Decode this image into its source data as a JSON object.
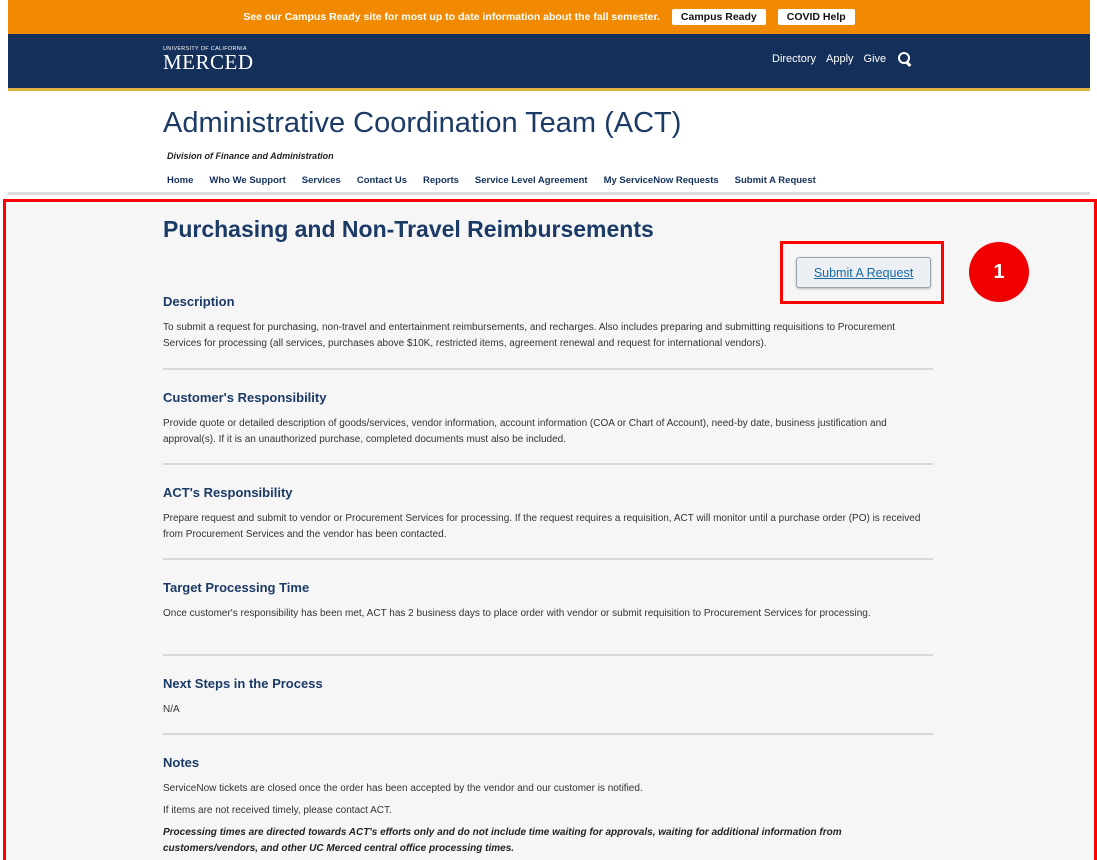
{
  "alert": {
    "text": "See our Campus Ready site for most up to date information about the fall semester.",
    "buttons": [
      "Campus Ready",
      "COVID Help"
    ]
  },
  "brand": {
    "logo_small": "UNIVERSITY OF CALIFORNIA",
    "logo_big": "MERCED",
    "links": [
      "Directory",
      "Apply",
      "Give"
    ],
    "icon": "search-icon"
  },
  "site": {
    "title": "Administrative Coordination Team (ACT)",
    "subtitle": "Division of Finance and Administration",
    "nav": [
      "Home",
      "Who We Support",
      "Services",
      "Contact Us",
      "Reports",
      "Service Level Agreement",
      "My ServiceNow Requests",
      "Submit A Request"
    ]
  },
  "page": {
    "title": "Purchasing and Non-Travel Reimbursements",
    "submit_label": "Submit A Request",
    "step_badge": "1",
    "sections": [
      {
        "heading": "Description",
        "paragraphs": [
          "To submit a request for purchasing, non-travel and entertainment reimbursements, and recharges. Also includes preparing and submitting requisitions to Procurement Services for processing (all services, purchases above $10K, restricted items, agreement renewal and request for international vendors)."
        ]
      },
      {
        "heading": "Customer's Responsibility",
        "paragraphs": [
          "Provide quote or detailed description of goods/services, vendor information, account information (COA or Chart of Account), need-by date, business justification and approval(s). If it is an unauthorized purchase, completed documents must also be included."
        ]
      },
      {
        "heading": "ACT's Responsibility",
        "paragraphs": [
          "Prepare request and submit to vendor or Procurement Services for processing. If the request requires a requisition, ACT will monitor until a purchase order (PO) is received from Procurement Services and the vendor has been contacted."
        ]
      },
      {
        "heading": "Target Processing Time",
        "paragraphs": [
          "Once customer's responsibility has been met, ACT has 2 business days to place order with vendor or submit requisition to Procurement Services for processing."
        ]
      },
      {
        "heading": "Next Steps in the Process",
        "paragraphs": [
          "N/A"
        ]
      },
      {
        "heading": "Notes",
        "paragraphs": [
          "ServiceNow tickets are closed once the order has been accepted by the vendor and our customer is notified.",
          "If items are not received timely, please contact ACT.",
          "Processing times are directed towards ACT's efforts only and do not include time waiting for approvals, waiting for additional information from customers/vendors, and other  UC Merced central office processing times."
        ]
      }
    ]
  },
  "colors": {
    "alert_bg": "#f18a00",
    "nav_bg": "#14305a",
    "title_blue": "#1b3a66",
    "annotation_red": "#ff0000"
  }
}
